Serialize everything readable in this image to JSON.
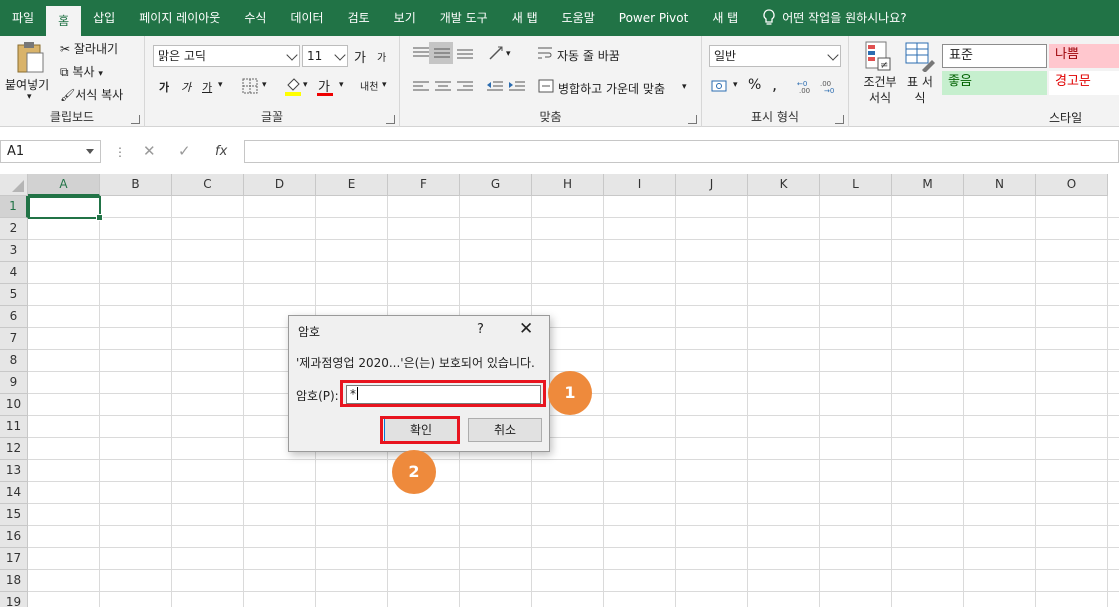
{
  "tabs": [
    "파일",
    "홈",
    "삽입",
    "페이지 레이아웃",
    "수식",
    "데이터",
    "검토",
    "보기",
    "개발 도구",
    "새 탭",
    "도움말",
    "Power Pivot",
    "새 탭"
  ],
  "tell_me": "어떤 작업을 원하시나요?",
  "ribbon": {
    "clipboard": {
      "paste": "붙여넣기",
      "cut": "잘라내기",
      "copy": "복사",
      "format_painter": "서식 복사",
      "label": "클립보드"
    },
    "font": {
      "name": "맑은 고딕",
      "size": "11",
      "grow": "가",
      "shrink": "가",
      "bold": "가",
      "italic": "가",
      "underline": "가",
      "font_color": "가",
      "phonetic": "내천",
      "label": "글꼴"
    },
    "alignment": {
      "wrap": "자동 줄 바꿈",
      "merge": "병합하고 가운데 맞춤",
      "label": "맞춤"
    },
    "number": {
      "format": "일반",
      "percent": "%",
      "comma": ",",
      "label": "표시 형식"
    },
    "styles": {
      "conditional": "조건부 서식",
      "table": "표 서식",
      "normal": "표준",
      "bad": "나쁨",
      "good": "좋음",
      "warning": "경고문",
      "label": "스타일"
    }
  },
  "namebox": "A1",
  "formula_buttons": {
    "cancel": "✕",
    "enter": "✓",
    "fx": "fx"
  },
  "columns": [
    "A",
    "B",
    "C",
    "D",
    "E",
    "F",
    "G",
    "H",
    "I",
    "J",
    "K",
    "L",
    "M",
    "N",
    "O"
  ],
  "rows": [
    "1",
    "2",
    "3",
    "4",
    "5",
    "6",
    "7",
    "8",
    "9",
    "10",
    "11",
    "12",
    "13",
    "14",
    "15",
    "16",
    "17",
    "18",
    "19"
  ],
  "dialog": {
    "title": "암호",
    "help": "?",
    "close": "✕",
    "message": "'제과점영업 2020...'은(는) 보호되어 있습니다.",
    "label": "암호(P):",
    "password": "*",
    "ok": "확인",
    "cancel": "취소"
  },
  "annotations": {
    "step1": "1",
    "step2": "2"
  },
  "colors": {
    "excel_green": "#217346",
    "highlight_red": "#e8141f",
    "badge_orange": "#ee8a3c"
  }
}
